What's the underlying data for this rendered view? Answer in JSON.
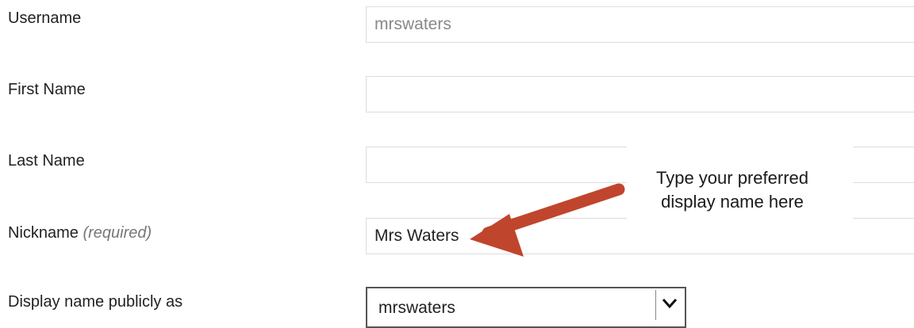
{
  "form": {
    "username": {
      "label": "Username",
      "value": "mrswaters"
    },
    "first_name": {
      "label": "First Name",
      "value": ""
    },
    "last_name": {
      "label": "Last Name",
      "value": ""
    },
    "nickname": {
      "label": "Nickname",
      "required_note": "(required)",
      "value": "Mrs Waters"
    },
    "display_name": {
      "label": "Display name publicly as",
      "selected": "mrswaters"
    }
  },
  "annotation": {
    "line1": "Type your preferred",
    "line2": "display name here",
    "arrow_color": "#c0452d"
  },
  "icons": {
    "dropdown": "chevron-down-icon",
    "pointer": "arrow-icon"
  }
}
